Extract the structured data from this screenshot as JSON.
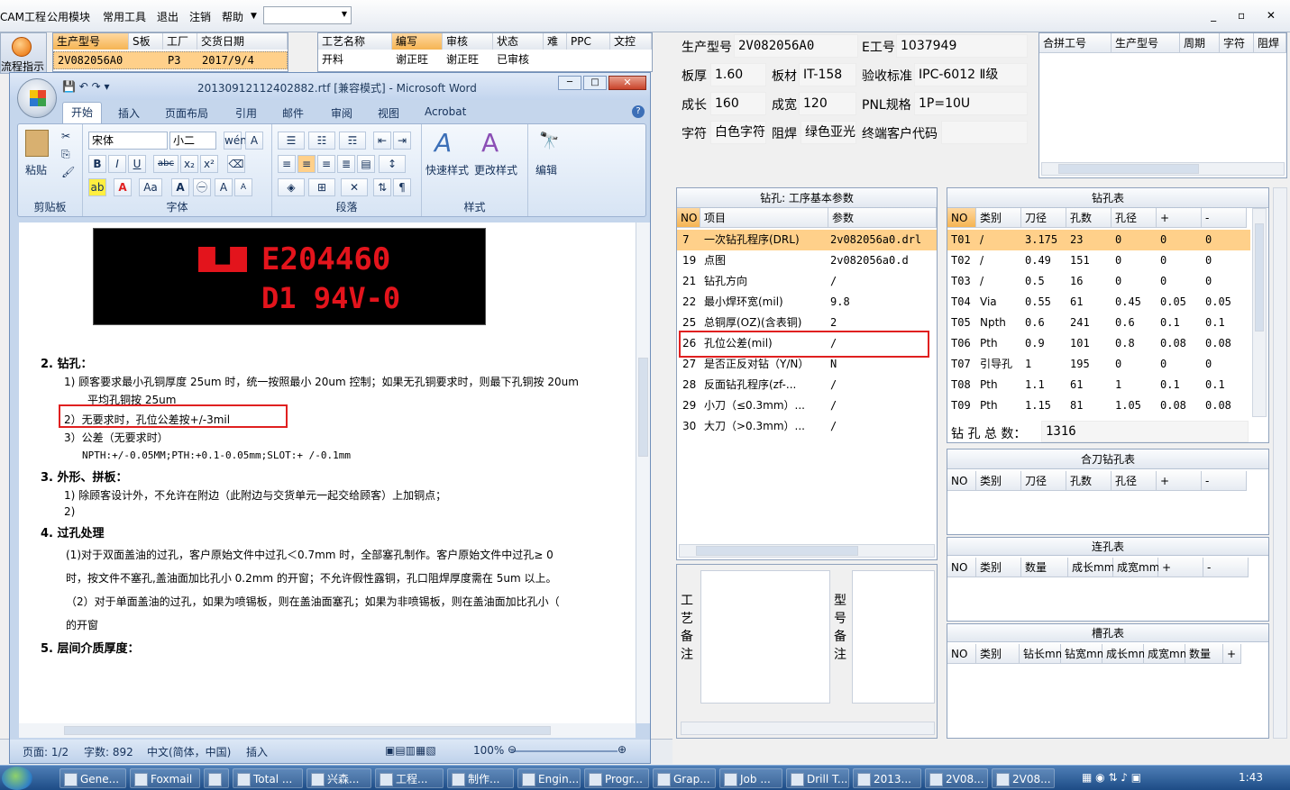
{
  "menu": {
    "items": [
      "CAM工程",
      "公用模块",
      "常用工具",
      "退出",
      "注销",
      "帮助"
    ],
    "win_controls": "_ ▫ ✕"
  },
  "flow_button": {
    "label": "流程指示"
  },
  "order_grid": {
    "headers": [
      "生产型号",
      "S板",
      "工厂",
      "交货日期"
    ],
    "row": [
      "2V082056A0",
      "",
      "P3",
      "2017/9/4"
    ]
  },
  "process_grid": {
    "headers": [
      "工艺名称",
      "编写",
      "审核",
      "状态",
      "难",
      "PPC",
      "文控"
    ],
    "row": [
      "开料",
      "谢正旺",
      "谢正旺",
      "已审核",
      "",
      "",
      ""
    ]
  },
  "word": {
    "title": "20130912112402882.rtf [兼容模式] - Microsoft Word",
    "tabs": [
      "开始",
      "插入",
      "页面布局",
      "引用",
      "邮件",
      "审阅",
      "视图",
      "Acrobat"
    ],
    "ribbon": {
      "paste": "粘贴",
      "clipboard": "剪贴板",
      "font_name": "宋体",
      "font_size": "小二",
      "font_group": "字体",
      "para_group": "段落",
      "style_quick": "快速样式",
      "style_change": "更改样式",
      "style_group": "样式",
      "edit": "编辑",
      "btn_bold": "B",
      "btn_italic": "I",
      "btn_underline": "U",
      "btn_strike": "abc",
      "btn_sub": "x₂",
      "btn_sup": "x²",
      "btn_aa": "Aa",
      "btn_grow": "A",
      "btn_shrink": "A"
    },
    "doc": {
      "ul_line1": "E204460",
      "ul_line2": "D1  94V-0",
      "h2": "2.  钻孔：",
      "p2_1": "1)  顾客要求最小孔铜厚度 25um 时，统一按照最小 20um 控制；如果无孔铜要求时，则最下孔铜按 20um",
      "p2_1b": "平均孔铜按 25um",
      "p2_2": "2）无要求时，孔位公差按+/-3mil",
      "p2_3": "3）公差（无要求时）",
      "p2_4": "NPTH:+/-0.05MM;PTH:+0.1-0.05mm;SLOT:+ /-0.1mm",
      "h3": "3.  外形、拼板：",
      "p3_1": "1)  除顾客设计外，不允许在附边（此附边与交货单元一起交给顾客）上加铜点；",
      "p3_2": "2)",
      "h4": "4.  过孔处理",
      "p4_1": "(1)对于双面盖油的过孔，客户原始文件中过孔＜0.7mm 时，全部塞孔制作。客户原始文件中过孔≥  0",
      "p4_1b": "时，按文件不塞孔,盖油面加比孔小 0.2mm 的开窗；不允许假性露铜，孔口阻焊厚度需在 5um 以上。",
      "p4_2": "（2）对于单面盖油的过孔，如果为喷锡板，则在盖油面塞孔；如果为非喷锡板，则在盖油面加比孔小（",
      "p4_2b": "的开窗",
      "h5": "5.  层间介质厚度："
    },
    "status": {
      "page": "页面: 1/2",
      "words": "字数: 892",
      "lang": "中文(简体，中国)",
      "mode": "插入",
      "zoom": "100%"
    }
  },
  "info": {
    "model_lbl": "生产型号",
    "model": "2V082056A0",
    "eno_lbl": "E工号",
    "eno": "1037949",
    "thick_lbl": "板厚",
    "thick": "1.60",
    "mat_lbl": "板材",
    "mat": "IT-158",
    "std_lbl": "验收标准",
    "std": "IPC-6012 Ⅱ级",
    "len_lbl": "成长",
    "len": "160",
    "wid_lbl": "成宽",
    "wid": "120",
    "pnl_lbl": "PNL规格",
    "pnl": "1P=10U",
    "char_lbl": "字符",
    "char": "白色字符",
    "mask_lbl": "阻焊",
    "mask": "绿色亚光",
    "cust_lbl": "终端客户代码",
    "cust": ""
  },
  "merge_grid": {
    "headers": [
      "合拼工号",
      "生产型号",
      "周期",
      "字符",
      "阻焊"
    ]
  },
  "params": {
    "title": "钻孔: 工序基本参数",
    "headers": [
      "NO",
      "项目",
      "参数"
    ],
    "rows": [
      [
        "7",
        "一次钻孔程序(DRL)",
        "2v082056a0.drl"
      ],
      [
        "19",
        "点图",
        "2v082056a0.d"
      ],
      [
        "21",
        "钻孔方向",
        "/"
      ],
      [
        "22",
        "最小焊环宽(mil)",
        "9.8"
      ],
      [
        "25",
        "总铜厚(OZ)(含表铜)",
        "2"
      ],
      [
        "26",
        "孔位公差(mil)",
        "/"
      ],
      [
        "27",
        "是否正反对钻（Y/N）",
        "N"
      ],
      [
        "28",
        "反面钻孔程序(zf-...",
        "/"
      ],
      [
        "29",
        "小刀（≤0.3mm）...",
        "/"
      ],
      [
        "30",
        "大刀（>0.3mm）...",
        "/"
      ]
    ]
  },
  "drill": {
    "title": "钻孔表",
    "headers": [
      "NO",
      "类别",
      "刀径",
      "孔数",
      "孔径",
      "+",
      "-"
    ],
    "rows": [
      [
        "T01",
        "/",
        "3.175",
        "23",
        "0",
        "0",
        "0"
      ],
      [
        "T02",
        "/",
        "0.49",
        "151",
        "0",
        "0",
        "0"
      ],
      [
        "T03",
        "/",
        "0.5",
        "16",
        "0",
        "0",
        "0"
      ],
      [
        "T04",
        "Via",
        "0.55",
        "61",
        "0.45",
        "0.05",
        "0.05"
      ],
      [
        "T05",
        "Npth",
        "0.6",
        "241",
        "0.6",
        "0.1",
        "0.1"
      ],
      [
        "T06",
        "Pth",
        "0.9",
        "101",
        "0.8",
        "0.08",
        "0.08"
      ],
      [
        "T07",
        "引导孔",
        "1",
        "195",
        "0",
        "0",
        "0"
      ],
      [
        "T08",
        "Pth",
        "1.1",
        "61",
        "1",
        "0.1",
        "0.1"
      ],
      [
        "T09",
        "Pth",
        "1.15",
        "81",
        "1.05",
        "0.08",
        "0.08"
      ]
    ],
    "total_lbl": "钻 孔 总 数：",
    "total": "1316"
  },
  "knife": {
    "title": "合刀钻孔表",
    "headers": [
      "NO",
      "类别",
      "刀径",
      "孔数",
      "孔径",
      "+",
      "-"
    ]
  },
  "link": {
    "title": "连孔表",
    "headers": [
      "NO",
      "类别",
      "数量",
      "成长mm",
      "成宽mm",
      "+",
      "-"
    ]
  },
  "slot": {
    "title": "槽孔表",
    "headers": [
      "NO",
      "类别",
      "钻长mm",
      "钻宽mm",
      "成长mm",
      "成宽mm",
      "数量",
      "+"
    ]
  },
  "notes": {
    "craft": "工艺备注",
    "model": "型号备注"
  },
  "taskbar": {
    "items": [
      "Gene...",
      "Foxmail",
      "",
      "Total ...",
      "兴森...",
      "工程...",
      "制作...",
      "Engin...",
      "Progr...",
      "Grap...",
      "Job ...",
      "Drill T...",
      "2013...",
      "2V08...",
      "2V08..."
    ],
    "clock": "1:43"
  },
  "colors": {
    "highlight": "#e02020",
    "ul_red": "#e3141c",
    "selected_row": "#ffd08a"
  }
}
